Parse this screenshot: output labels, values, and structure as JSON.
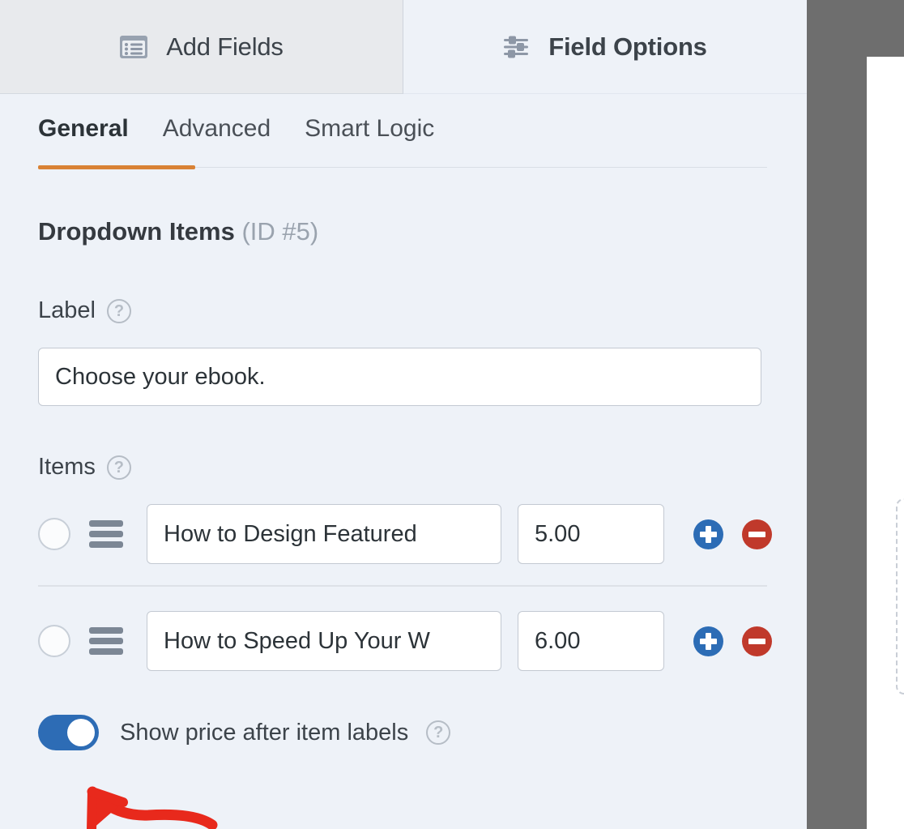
{
  "top_tabs": [
    {
      "label": "Add Fields",
      "icon": "form-list-icon",
      "active": false
    },
    {
      "label": "Field Options",
      "icon": "sliders-icon",
      "active": true
    }
  ],
  "sub_tabs": [
    {
      "label": "General",
      "active": true
    },
    {
      "label": "Advanced",
      "active": false
    },
    {
      "label": "Smart Logic",
      "active": false
    }
  ],
  "section": {
    "title": "Dropdown Items",
    "id_text": "(ID #5)"
  },
  "label_field": {
    "label": "Label",
    "help_glyph": "?",
    "value": "Choose your ebook."
  },
  "items_field": {
    "label": "Items",
    "help_glyph": "?",
    "rows": [
      {
        "text": "How to Design Featured",
        "price": "5.00",
        "add_label": "+",
        "remove_label": "−"
      },
      {
        "text": "How to Speed Up Your W",
        "price": "6.00",
        "add_label": "+",
        "remove_label": "−"
      }
    ]
  },
  "price_toggle": {
    "label": "Show price after item labels",
    "help_glyph": "?",
    "state": "on"
  },
  "colors": {
    "accent_orange": "#d98235",
    "toggle_blue": "#2d6cb5",
    "add_blue": "#2c6cb5",
    "remove_red": "#c0392b",
    "panel_bg": "#eef2f8",
    "inactive_tab_bg": "#e8eaed",
    "overlay_gray": "#6e6e6e",
    "annotation_red": "#e8291c"
  }
}
